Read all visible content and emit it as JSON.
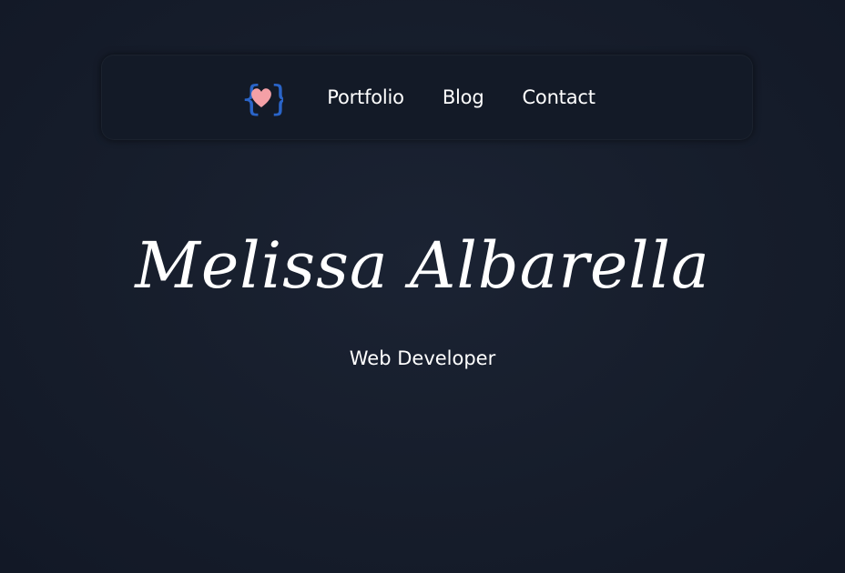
{
  "nav": {
    "logo_icon": "curly-braces-heart-icon",
    "links": [
      {
        "label": "Portfolio"
      },
      {
        "label": "Blog"
      },
      {
        "label": "Contact"
      }
    ]
  },
  "hero": {
    "name": "Melissa Albarella",
    "subtitle": "Web Developer"
  },
  "colors": {
    "background": "#161d2b",
    "nav_background": "#131a27",
    "text": "#ffffff",
    "brace_blue": "#2a64c8",
    "heart_pink": "#f4a0a6"
  }
}
